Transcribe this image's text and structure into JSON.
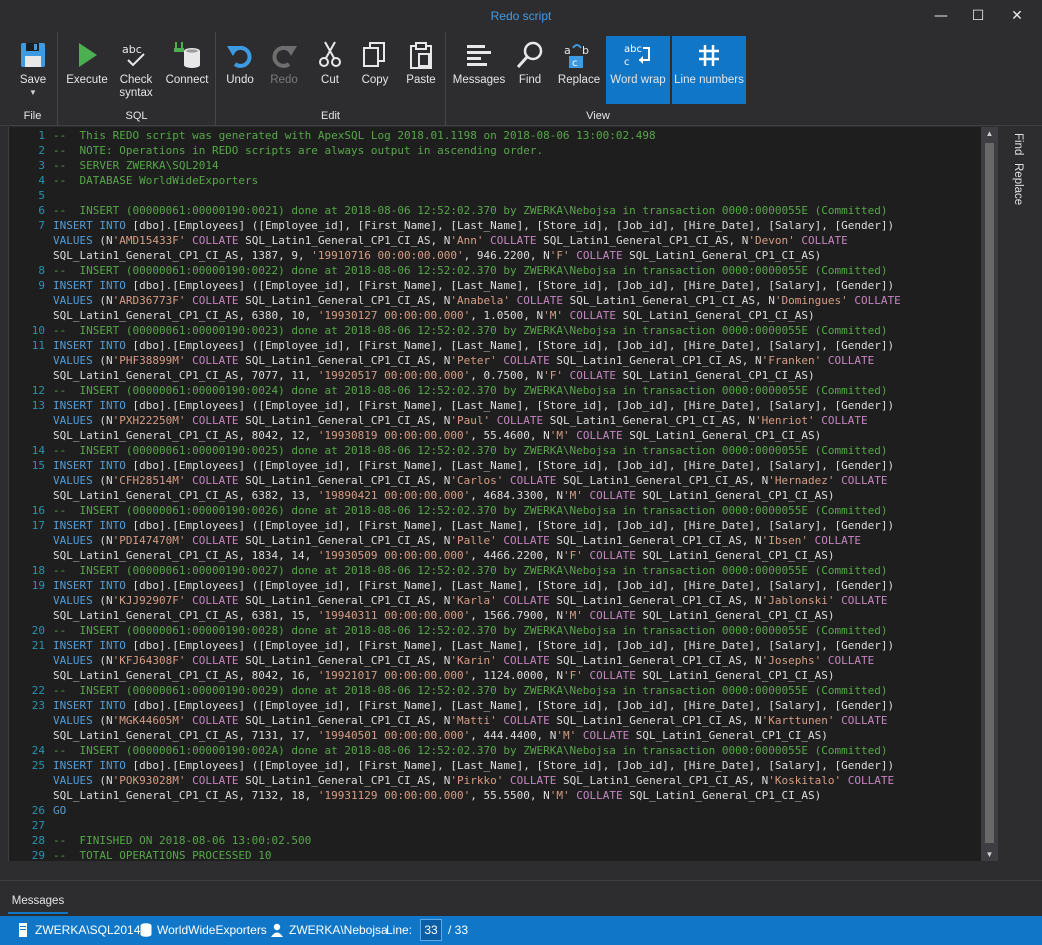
{
  "window": {
    "title": "Redo script"
  },
  "ribbon": {
    "file": {
      "label": "File",
      "save": "Save"
    },
    "sql": {
      "label": "SQL",
      "execute": "Execute",
      "check": "Check\nsyntax",
      "connect": "Connect"
    },
    "edit": {
      "label": "Edit",
      "undo": "Undo",
      "redo": "Redo",
      "cut": "Cut",
      "copy": "Copy",
      "paste": "Paste"
    },
    "view": {
      "label": "View",
      "messages": "Messages",
      "find": "Find",
      "replace": "Replace",
      "word_wrap": "Word wrap",
      "line_numbers": "Line numbers"
    }
  },
  "side_panel": {
    "find": "Find",
    "replace": "Replace"
  },
  "bottom_tab": "Messages",
  "status": {
    "server": "ZWERKA\\SQL2014",
    "database": "WorldWideExporters",
    "user": "ZWERKA\\Nebojsa",
    "line_label": "Line:",
    "line_current": "33",
    "line_total": "/ 33"
  },
  "editor_lines": [
    {
      "n": "1",
      "t": "--  This REDO script was generated with ApexSQL Log 2018.01.1198 on 2018-08-06 13:00:02.498"
    },
    {
      "n": "2",
      "t": "--  NOTE: Operations in REDO scripts are always output in ascending order."
    },
    {
      "n": "3",
      "t": "--  SERVER ZWERKA\\SQL2014"
    },
    {
      "n": "4",
      "t": "--  DATABASE WorldWideExporters"
    },
    {
      "n": "5",
      "t": ""
    },
    {
      "n": "6",
      "t": "--  INSERT (00000061:00000190:0021) done at 2018-08-06 12:52:02.370 by ZWERKA\\Nebojsa in transaction 0000:0000055E (Committed)"
    },
    {
      "n": "7",
      "t": "INSERT INTO [dbo].[Employees] ([Employee_id], [First_Name], [Last_Name], [Store_id], [Job_id], [Hire_Date], [Salary], [Gender])"
    },
    {
      "n": "",
      "t": "VALUES (N'AMD15433F' COLLATE SQL_Latin1_General_CP1_CI_AS, N'Ann' COLLATE SQL_Latin1_General_CP1_CI_AS, N'Devon' COLLATE"
    },
    {
      "n": "",
      "t": "SQL_Latin1_General_CP1_CI_AS, 1387, 9, '19910716 00:00:00.000', 946.2200, N'F' COLLATE SQL_Latin1_General_CP1_CI_AS)"
    },
    {
      "n": "8",
      "t": "--  INSERT (00000061:00000190:0022) done at 2018-08-06 12:52:02.370 by ZWERKA\\Nebojsa in transaction 0000:0000055E (Committed)"
    },
    {
      "n": "9",
      "t": "INSERT INTO [dbo].[Employees] ([Employee_id], [First_Name], [Last_Name], [Store_id], [Job_id], [Hire_Date], [Salary], [Gender])"
    },
    {
      "n": "",
      "t": "VALUES (N'ARD36773F' COLLATE SQL_Latin1_General_CP1_CI_AS, N'Anabela' COLLATE SQL_Latin1_General_CP1_CI_AS, N'Domingues' COLLATE"
    },
    {
      "n": "",
      "t": "SQL_Latin1_General_CP1_CI_AS, 6380, 10, '19930127 00:00:00.000', 1.0500, N'M' COLLATE SQL_Latin1_General_CP1_CI_AS)"
    },
    {
      "n": "10",
      "t": "--  INSERT (00000061:00000190:0023) done at 2018-08-06 12:52:02.370 by ZWERKA\\Nebojsa in transaction 0000:0000055E (Committed)"
    },
    {
      "n": "11",
      "t": "INSERT INTO [dbo].[Employees] ([Employee_id], [First_Name], [Last_Name], [Store_id], [Job_id], [Hire_Date], [Salary], [Gender])"
    },
    {
      "n": "",
      "t": "VALUES (N'PHF38899M' COLLATE SQL_Latin1_General_CP1_CI_AS, N'Peter' COLLATE SQL_Latin1_General_CP1_CI_AS, N'Franken' COLLATE"
    },
    {
      "n": "",
      "t": "SQL_Latin1_General_CP1_CI_AS, 7077, 11, '19920517 00:00:00.000', 0.7500, N'F' COLLATE SQL_Latin1_General_CP1_CI_AS)"
    },
    {
      "n": "12",
      "t": "--  INSERT (00000061:00000190:0024) done at 2018-08-06 12:52:02.370 by ZWERKA\\Nebojsa in transaction 0000:0000055E (Committed)"
    },
    {
      "n": "13",
      "t": "INSERT INTO [dbo].[Employees] ([Employee_id], [First_Name], [Last_Name], [Store_id], [Job_id], [Hire_Date], [Salary], [Gender])"
    },
    {
      "n": "",
      "t": "VALUES (N'PXH22250M' COLLATE SQL_Latin1_General_CP1_CI_AS, N'Paul' COLLATE SQL_Latin1_General_CP1_CI_AS, N'Henriot' COLLATE"
    },
    {
      "n": "",
      "t": "SQL_Latin1_General_CP1_CI_AS, 8042, 12, '19930819 00:00:00.000', 55.4600, N'M' COLLATE SQL_Latin1_General_CP1_CI_AS)"
    },
    {
      "n": "14",
      "t": "--  INSERT (00000061:00000190:0025) done at 2018-08-06 12:52:02.370 by ZWERKA\\Nebojsa in transaction 0000:0000055E (Committed)"
    },
    {
      "n": "15",
      "t": "INSERT INTO [dbo].[Employees] ([Employee_id], [First_Name], [Last_Name], [Store_id], [Job_id], [Hire_Date], [Salary], [Gender])"
    },
    {
      "n": "",
      "t": "VALUES (N'CFH28514M' COLLATE SQL_Latin1_General_CP1_CI_AS, N'Carlos' COLLATE SQL_Latin1_General_CP1_CI_AS, N'Hernadez' COLLATE"
    },
    {
      "n": "",
      "t": "SQL_Latin1_General_CP1_CI_AS, 6382, 13, '19890421 00:00:00.000', 4684.3300, N'M' COLLATE SQL_Latin1_General_CP1_CI_AS)"
    },
    {
      "n": "16",
      "t": "--  INSERT (00000061:00000190:0026) done at 2018-08-06 12:52:02.370 by ZWERKA\\Nebojsa in transaction 0000:0000055E (Committed)"
    },
    {
      "n": "17",
      "t": "INSERT INTO [dbo].[Employees] ([Employee_id], [First_Name], [Last_Name], [Store_id], [Job_id], [Hire_Date], [Salary], [Gender])"
    },
    {
      "n": "",
      "t": "VALUES (N'PDI47470M' COLLATE SQL_Latin1_General_CP1_CI_AS, N'Palle' COLLATE SQL_Latin1_General_CP1_CI_AS, N'Ibsen' COLLATE"
    },
    {
      "n": "",
      "t": "SQL_Latin1_General_CP1_CI_AS, 1834, 14, '19930509 00:00:00.000', 4466.2200, N'F' COLLATE SQL_Latin1_General_CP1_CI_AS)"
    },
    {
      "n": "18",
      "t": "--  INSERT (00000061:00000190:0027) done at 2018-08-06 12:52:02.370 by ZWERKA\\Nebojsa in transaction 0000:0000055E (Committed)"
    },
    {
      "n": "19",
      "t": "INSERT INTO [dbo].[Employees] ([Employee_id], [First_Name], [Last_Name], [Store_id], [Job_id], [Hire_Date], [Salary], [Gender])"
    },
    {
      "n": "",
      "t": "VALUES (N'KJJ92907F' COLLATE SQL_Latin1_General_CP1_CI_AS, N'Karla' COLLATE SQL_Latin1_General_CP1_CI_AS, N'Jablonski' COLLATE"
    },
    {
      "n": "",
      "t": "SQL_Latin1_General_CP1_CI_AS, 6381, 15, '19940311 00:00:00.000', 1566.7900, N'M' COLLATE SQL_Latin1_General_CP1_CI_AS)"
    },
    {
      "n": "20",
      "t": "--  INSERT (00000061:00000190:0028) done at 2018-08-06 12:52:02.370 by ZWERKA\\Nebojsa in transaction 0000:0000055E (Committed)"
    },
    {
      "n": "21",
      "t": "INSERT INTO [dbo].[Employees] ([Employee_id], [First_Name], [Last_Name], [Store_id], [Job_id], [Hire_Date], [Salary], [Gender])"
    },
    {
      "n": "",
      "t": "VALUES (N'KFJ64308F' COLLATE SQL_Latin1_General_CP1_CI_AS, N'Karin' COLLATE SQL_Latin1_General_CP1_CI_AS, N'Josephs' COLLATE"
    },
    {
      "n": "",
      "t": "SQL_Latin1_General_CP1_CI_AS, 8042, 16, '19921017 00:00:00.000', 1124.0000, N'F' COLLATE SQL_Latin1_General_CP1_CI_AS)"
    },
    {
      "n": "22",
      "t": "--  INSERT (00000061:00000190:0029) done at 2018-08-06 12:52:02.370 by ZWERKA\\Nebojsa in transaction 0000:0000055E (Committed)"
    },
    {
      "n": "23",
      "t": "INSERT INTO [dbo].[Employees] ([Employee_id], [First_Name], [Last_Name], [Store_id], [Job_id], [Hire_Date], [Salary], [Gender])"
    },
    {
      "n": "",
      "t": "VALUES (N'MGK44605M' COLLATE SQL_Latin1_General_CP1_CI_AS, N'Matti' COLLATE SQL_Latin1_General_CP1_CI_AS, N'Karttunen' COLLATE"
    },
    {
      "n": "",
      "t": "SQL_Latin1_General_CP1_CI_AS, 7131, 17, '19940501 00:00:00.000', 444.4400, N'M' COLLATE SQL_Latin1_General_CP1_CI_AS)"
    },
    {
      "n": "24",
      "t": "--  INSERT (00000061:00000190:002A) done at 2018-08-06 12:52:02.370 by ZWERKA\\Nebojsa in transaction 0000:0000055E (Committed)"
    },
    {
      "n": "25",
      "t": "INSERT INTO [dbo].[Employees] ([Employee_id], [First_Name], [Last_Name], [Store_id], [Job_id], [Hire_Date], [Salary], [Gender])"
    },
    {
      "n": "",
      "t": "VALUES (N'POK93028M' COLLATE SQL_Latin1_General_CP1_CI_AS, N'Pirkko' COLLATE SQL_Latin1_General_CP1_CI_AS, N'Koskitalo' COLLATE"
    },
    {
      "n": "",
      "t": "SQL_Latin1_General_CP1_CI_AS, 7132, 18, '19931129 00:00:00.000', 55.5500, N'M' COLLATE SQL_Latin1_General_CP1_CI_AS)"
    },
    {
      "n": "26",
      "t": "GO"
    },
    {
      "n": "27",
      "t": ""
    },
    {
      "n": "28",
      "t": "--  FINISHED ON 2018-08-06 13:00:02.500"
    },
    {
      "n": "29",
      "t": "--  TOTAL OPERATIONS PROCESSED 10"
    }
  ]
}
